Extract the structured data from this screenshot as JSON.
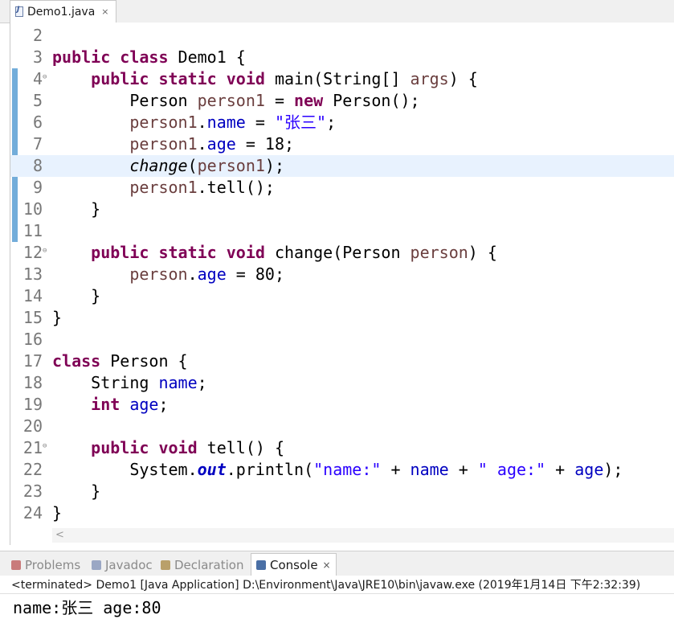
{
  "editor_tab": {
    "title": "Demo1.java",
    "close": "×"
  },
  "lines": [
    {
      "num": "2",
      "fold": "",
      "segs": []
    },
    {
      "num": "3",
      "fold": "",
      "segs": [
        {
          "t": "public class ",
          "c": "kw"
        },
        {
          "t": "Demo1 {",
          "c": ""
        }
      ]
    },
    {
      "num": "4",
      "fold": "⊖",
      "segs": [
        {
          "t": "    ",
          "c": ""
        },
        {
          "t": "public static void ",
          "c": "kw"
        },
        {
          "t": "main(String[] ",
          "c": ""
        },
        {
          "t": "args",
          "c": "var"
        },
        {
          "t": ") {",
          "c": ""
        }
      ]
    },
    {
      "num": "5",
      "fold": "",
      "segs": [
        {
          "t": "        Person ",
          "c": ""
        },
        {
          "t": "person1",
          "c": "var"
        },
        {
          "t": " = ",
          "c": ""
        },
        {
          "t": "new ",
          "c": "kw"
        },
        {
          "t": "Person();",
          "c": ""
        }
      ]
    },
    {
      "num": "6",
      "fold": "",
      "segs": [
        {
          "t": "        ",
          "c": ""
        },
        {
          "t": "person1",
          "c": "var"
        },
        {
          "t": ".",
          "c": ""
        },
        {
          "t": "name",
          "c": "fld"
        },
        {
          "t": " = ",
          "c": ""
        },
        {
          "t": "\"张三\"",
          "c": "str"
        },
        {
          "t": ";",
          "c": ""
        }
      ]
    },
    {
      "num": "7",
      "fold": "",
      "segs": [
        {
          "t": "        ",
          "c": ""
        },
        {
          "t": "person1",
          "c": "var"
        },
        {
          "t": ".",
          "c": ""
        },
        {
          "t": "age",
          "c": "fld"
        },
        {
          "t": " = 18;",
          "c": ""
        }
      ]
    },
    {
      "num": "8",
      "fold": "",
      "current": true,
      "segs": [
        {
          "t": "        ",
          "c": ""
        },
        {
          "t": "change",
          "c": "ital"
        },
        {
          "t": "(",
          "c": ""
        },
        {
          "t": "person1",
          "c": "var"
        },
        {
          "t": ");",
          "c": ""
        }
      ]
    },
    {
      "num": "9",
      "fold": "",
      "segs": [
        {
          "t": "        ",
          "c": ""
        },
        {
          "t": "person1",
          "c": "var"
        },
        {
          "t": ".tell();",
          "c": ""
        }
      ]
    },
    {
      "num": "10",
      "fold": "",
      "segs": [
        {
          "t": "    }",
          "c": ""
        }
      ]
    },
    {
      "num": "11",
      "fold": "",
      "segs": []
    },
    {
      "num": "12",
      "fold": "⊖",
      "segs": [
        {
          "t": "    ",
          "c": ""
        },
        {
          "t": "public static void ",
          "c": "kw"
        },
        {
          "t": "change(Person ",
          "c": ""
        },
        {
          "t": "person",
          "c": "var"
        },
        {
          "t": ") {",
          "c": ""
        }
      ]
    },
    {
      "num": "13",
      "fold": "",
      "segs": [
        {
          "t": "        ",
          "c": ""
        },
        {
          "t": "person",
          "c": "var"
        },
        {
          "t": ".",
          "c": ""
        },
        {
          "t": "age",
          "c": "fld"
        },
        {
          "t": " = 80;",
          "c": ""
        }
      ]
    },
    {
      "num": "14",
      "fold": "",
      "segs": [
        {
          "t": "    }",
          "c": ""
        }
      ]
    },
    {
      "num": "15",
      "fold": "",
      "segs": [
        {
          "t": "}",
          "c": ""
        }
      ]
    },
    {
      "num": "16",
      "fold": "",
      "segs": []
    },
    {
      "num": "17",
      "fold": "",
      "segs": [
        {
          "t": "class ",
          "c": "kw"
        },
        {
          "t": "Person {",
          "c": ""
        }
      ]
    },
    {
      "num": "18",
      "fold": "",
      "segs": [
        {
          "t": "    String ",
          "c": ""
        },
        {
          "t": "name",
          "c": "fld"
        },
        {
          "t": ";",
          "c": ""
        }
      ]
    },
    {
      "num": "19",
      "fold": "",
      "segs": [
        {
          "t": "    ",
          "c": ""
        },
        {
          "t": "int ",
          "c": "kw"
        },
        {
          "t": "age",
          "c": "fld"
        },
        {
          "t": ";",
          "c": ""
        }
      ]
    },
    {
      "num": "20",
      "fold": "",
      "segs": []
    },
    {
      "num": "21",
      "fold": "⊖",
      "segs": [
        {
          "t": "    ",
          "c": ""
        },
        {
          "t": "public void ",
          "c": "kw"
        },
        {
          "t": "tell() {",
          "c": ""
        }
      ]
    },
    {
      "num": "22",
      "fold": "",
      "segs": [
        {
          "t": "        System.",
          "c": ""
        },
        {
          "t": "out",
          "c": "fld ital kw2"
        },
        {
          "t": ".println(",
          "c": ""
        },
        {
          "t": "\"name:\"",
          "c": "str"
        },
        {
          "t": " + ",
          "c": ""
        },
        {
          "t": "name",
          "c": "fld"
        },
        {
          "t": " + ",
          "c": ""
        },
        {
          "t": "\" age:\"",
          "c": "str"
        },
        {
          "t": " + ",
          "c": ""
        },
        {
          "t": "age",
          "c": "fld"
        },
        {
          "t": ");",
          "c": ""
        }
      ]
    },
    {
      "num": "23",
      "fold": "",
      "segs": [
        {
          "t": "    }",
          "c": ""
        }
      ]
    },
    {
      "num": "24",
      "fold": "",
      "segs": [
        {
          "t": "}",
          "c": ""
        }
      ]
    }
  ],
  "scroll_left": "<",
  "console_tabs": [
    {
      "label": "Problems",
      "icon_color": "#c97b7b",
      "active": false
    },
    {
      "label": "Javadoc",
      "icon_color": "#9aa7c4",
      "active": false
    },
    {
      "label": "Declaration",
      "icon_color": "#b9a06a",
      "active": false
    },
    {
      "label": "Console",
      "icon_color": "#4a6fa5",
      "active": true
    }
  ],
  "console_close": "×",
  "console_status": "<terminated> Demo1 [Java Application] D:\\Environment\\Java\\JRE10\\bin\\javaw.exe (2019年1月14日 下午2:32:39)",
  "console_output": "name:张三 age:80"
}
